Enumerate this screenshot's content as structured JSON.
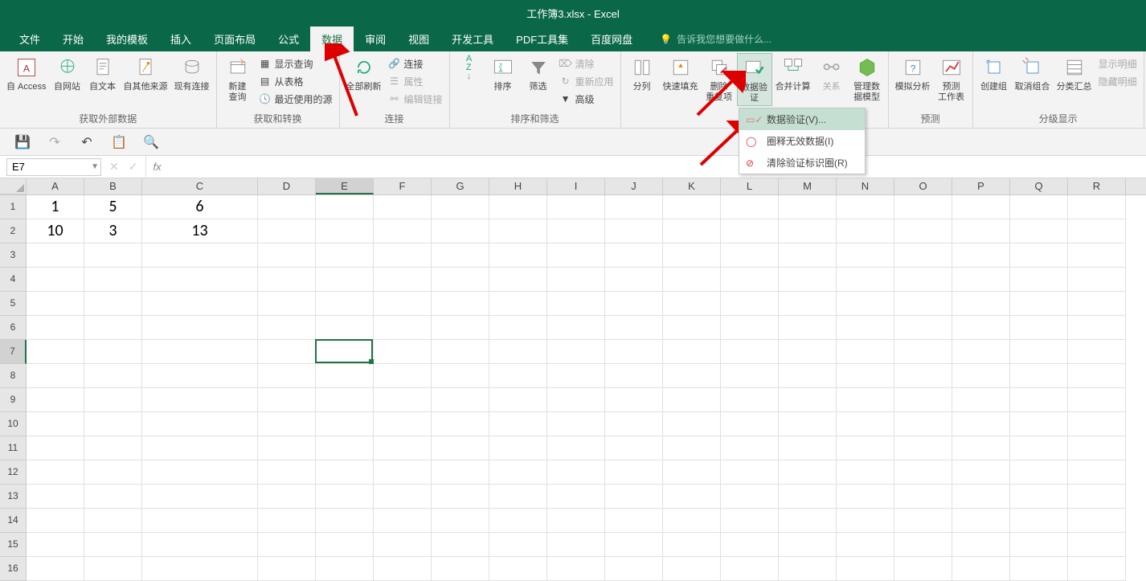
{
  "title": "工作簿3.xlsx - Excel",
  "tabs": [
    "文件",
    "开始",
    "我的模板",
    "插入",
    "页面布局",
    "公式",
    "数据",
    "审阅",
    "视图",
    "开发工具",
    "PDF工具集",
    "百度网盘"
  ],
  "active_tab_index": 6,
  "tell_me": "告诉我您想要做什么...",
  "ribbon": {
    "groups": [
      {
        "label": "获取外部数据",
        "items": [
          "自 Access",
          "自网站",
          "自文本",
          "自其他来源",
          "现有连接"
        ]
      },
      {
        "label": "获取和转换",
        "query": "新建\n查询",
        "rows": [
          "显示查询",
          "从表格",
          "最近使用的源"
        ]
      },
      {
        "label": "连接",
        "refresh": "全部刷新",
        "rows": [
          "连接",
          "属性",
          "编辑链接"
        ]
      },
      {
        "label": "排序和筛选",
        "sort": "排序",
        "filter": "筛选",
        "rows": [
          "清除",
          "重新应用",
          "高级"
        ]
      },
      {
        "label": "",
        "cols": "分列",
        "flash": "快速填充",
        "dup": "删除\n重复项",
        "valid": "数据验\n证",
        "consol": "合并计算",
        "rel": "关系",
        "model": "管理数\n据模型"
      },
      {
        "label": "预测",
        "whatif": "模拟分析",
        "forecast": "预测\n工作表"
      },
      {
        "label": "分级显示",
        "grp": "创建组",
        "ungrp": "取消组合",
        "subtotal": "分类汇总",
        "show": "显示明细",
        "hide": "隐藏明细"
      }
    ]
  },
  "dropdown": {
    "items": [
      "数据验证(V)...",
      "圈释无效数据(I)",
      "清除验证标识圈(R)"
    ]
  },
  "name_box": "E7",
  "columns": [
    "A",
    "B",
    "C",
    "D",
    "E",
    "F",
    "G",
    "H",
    "I",
    "J",
    "K",
    "L",
    "M",
    "N",
    "O",
    "P",
    "Q",
    "R"
  ],
  "selected_col": "E",
  "wide_col": "C",
  "cells": {
    "r1": {
      "A": "1",
      "B": "5",
      "C": "6"
    },
    "r2": {
      "A": "10",
      "B": "3",
      "C": "13"
    }
  },
  "row_count": 16,
  "selected_row": 7
}
